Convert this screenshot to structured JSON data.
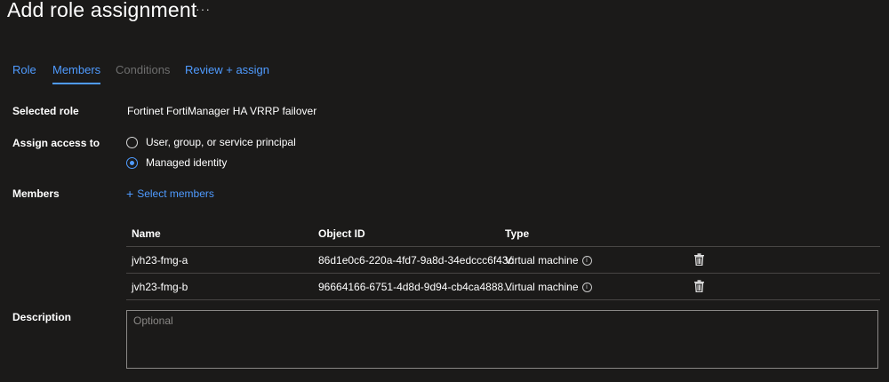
{
  "header": {
    "title": "Add role assignment",
    "more": "···"
  },
  "tabs": [
    {
      "label": "Role",
      "state": "normal"
    },
    {
      "label": "Members",
      "state": "active"
    },
    {
      "label": "Conditions",
      "state": "disabled"
    },
    {
      "label": "Review + assign",
      "state": "normal"
    }
  ],
  "form": {
    "selected_role_label": "Selected role",
    "selected_role_value": "Fortinet FortiManager HA VRRP failover",
    "assign_access_label": "Assign access to",
    "assign_options": [
      {
        "label": "User, group, or service principal",
        "checked": false
      },
      {
        "label": "Managed identity",
        "checked": true
      }
    ],
    "members_label": "Members",
    "select_members_label": "Select members",
    "description_label": "Description",
    "description_placeholder": "Optional",
    "description_value": ""
  },
  "members_table": {
    "columns": [
      "Name",
      "Object ID",
      "Type"
    ],
    "rows": [
      {
        "name": "jvh23-fmg-a",
        "object_id": "86d1e0c6-220a-4fd7-9a8d-34edccc6f43c",
        "type": "Virtual machine"
      },
      {
        "name": "jvh23-fmg-b",
        "object_id": "96664166-6751-4d8d-9d94-cb4ca4888...",
        "type": "Virtual machine"
      }
    ]
  },
  "colors": {
    "background": "#1b1a19",
    "accent": "#4f9bff",
    "disabled": "#6e6e6e",
    "border": "#484644"
  },
  "icons": {
    "more": "more-icon",
    "plus": "plus-icon",
    "info": "info-icon",
    "delete": "trash-icon"
  }
}
